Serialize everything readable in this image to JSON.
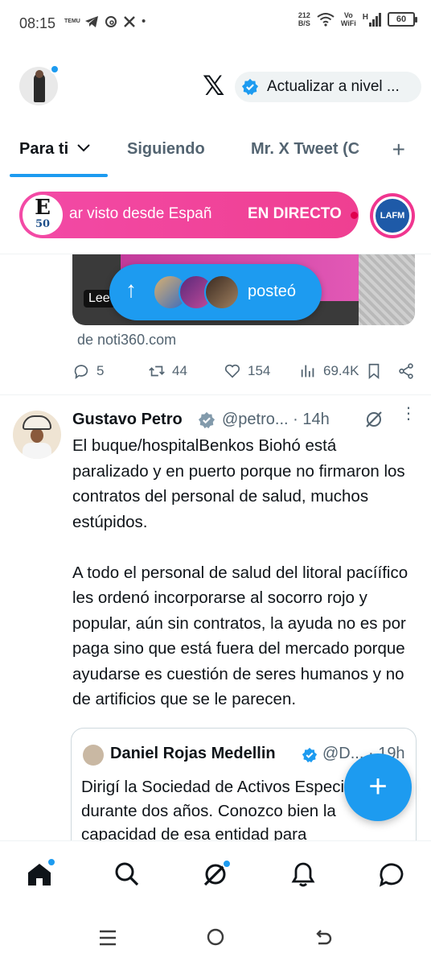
{
  "status_bar": {
    "time": "08:15",
    "left_icons": [
      "temu-icon",
      "telegram-icon",
      "threads-icon",
      "x-icon"
    ],
    "temu_text": "TEMU",
    "dot": "•",
    "speed_value": "212",
    "speed_unit": "B/S",
    "network_label_1": "Vo",
    "network_label_2": "WiFi",
    "signal_h": "H",
    "battery": "60"
  },
  "header": {
    "upgrade_label": "Actualizar a nivel ...",
    "accent_color": "#1d9bf0"
  },
  "tabs": {
    "items": [
      {
        "label": "Para ti"
      },
      {
        "label": "Siguiendo"
      },
      {
        "label": "Mr. X Tweet (C"
      }
    ],
    "add": "+"
  },
  "live": {
    "logo_letter": "E",
    "logo_number": "50",
    "scrolling_text": "ar visto desde Españ",
    "badge": "EN DIRECTO",
    "second_logo": "LAFM"
  },
  "prev_tweet": {
    "image_label": "Lee",
    "posted_label": "posteó",
    "source": "de noti360.com",
    "replies": "5",
    "reposts": "44",
    "likes": "154",
    "views": "69.4K"
  },
  "tweet": {
    "name": "Gustavo Petro",
    "handle": "@petro...",
    "time": "· 14h",
    "paragraphs": [
      "El buque/hospitalBenkos  Biohó está paralizado y en puerto porque no firmaron los contratos del personal de salud, muchos estúpidos.",
      "A todo el personal de salud del litoral pacíífico les ordenó incorporarse al socorro rojo y popular, aún sin contratos, la ayuda no es por paga sino que está fuera del mercado porque ayudarse es cuestión de seres humanos y no de artificios que se le parecen."
    ]
  },
  "quote": {
    "name": "Daniel Rojas Medellin",
    "handle": "@D... · 19h",
    "text": "Dirigí la Sociedad de Activos Especiales durante dos años. Conozco bien la capacidad de esa entidad para"
  },
  "fab": "+",
  "bottom_nav": [
    "home-icon",
    "search-icon",
    "grok-icon",
    "notifications-icon",
    "messages-icon"
  ]
}
